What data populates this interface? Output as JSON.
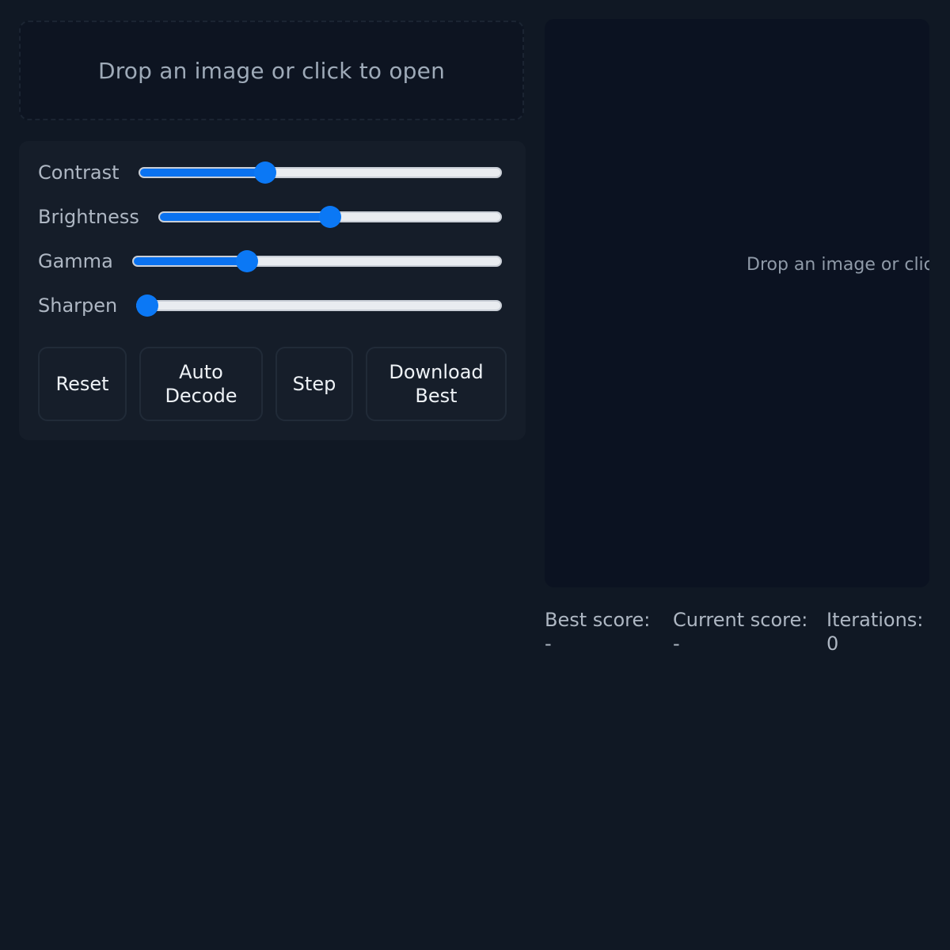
{
  "dropzone": {
    "text": "Drop an image or click to open"
  },
  "controls": {
    "sliders": [
      {
        "label": "Contrast",
        "value": 0.34
      },
      {
        "label": "Brightness",
        "value": 0.5
      },
      {
        "label": "Gamma",
        "value": 0.3
      },
      {
        "label": "Sharpen",
        "value": 0.0
      }
    ],
    "buttons": {
      "reset": "Reset",
      "auto_decode": "Auto\nDecode",
      "step": "Step",
      "download_best": "Download\nBest"
    }
  },
  "preview": {
    "text": "Drop an image or click to open"
  },
  "stats": {
    "best_label": "Best score:",
    "best_value": "-",
    "current_label": "Current score:",
    "current_value": "-",
    "iterations_label": "Iterations:",
    "iterations_value": "0"
  },
  "colors": {
    "accent": "#0b78f5",
    "background": "#101824",
    "panel": "#151d29"
  }
}
